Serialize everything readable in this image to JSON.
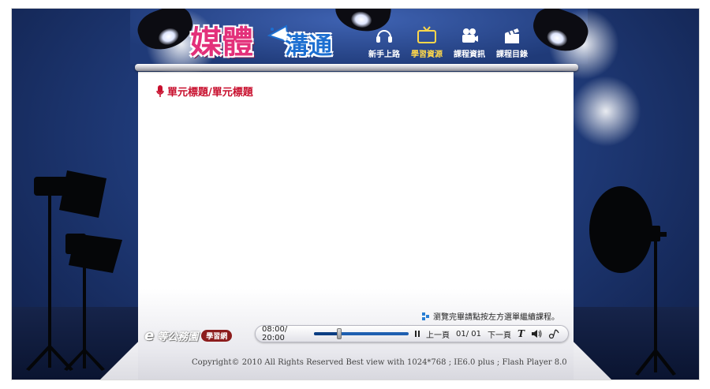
{
  "header": {
    "logo_main": "媒體",
    "logo_sub": "溝通",
    "nav": [
      {
        "label": "新手上路",
        "icon": "headphones-icon",
        "active": false
      },
      {
        "label": "學習資源",
        "icon": "tv-icon",
        "active": true
      },
      {
        "label": "課程資訊",
        "icon": "camera-icon",
        "active": false
      },
      {
        "label": "課程目錄",
        "icon": "clapperboard-icon",
        "active": false
      }
    ]
  },
  "content": {
    "title": "單元標題/單元標題",
    "hint": "瀏覽完畢請點按左方選單繼續課程。"
  },
  "brand": {
    "e": "e",
    "name": "等公務園",
    "badge": "學習網"
  },
  "player": {
    "time": "08:00/ 20:00",
    "progress": 0.27,
    "prev_label": "上一頁",
    "page": "01/ 01",
    "next_label": "下一頁",
    "text_tool": "T"
  },
  "footer": {
    "copyright": "Copyright© 2010 All Rights Reserved Best view with 1024*768 ; IE6.0 plus ; Flash Player 8.0"
  },
  "colors": {
    "accent_title": "#c8102e",
    "logo_pink": "#e3307a",
    "logo_blue": "#1d6fd1",
    "active_nav": "#ffd84a",
    "player_track": "#1e5fb0"
  }
}
